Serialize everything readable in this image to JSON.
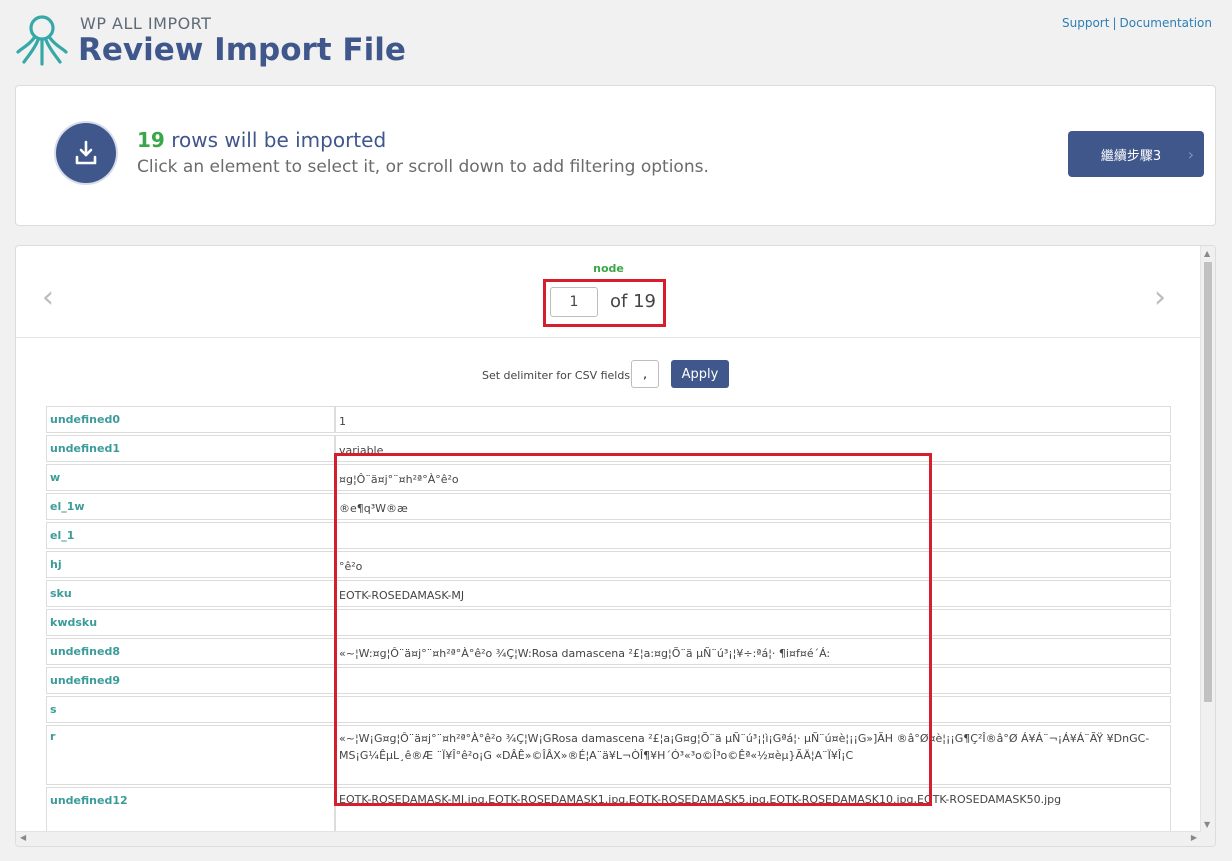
{
  "header": {
    "brand": "WP ALL IMPORT",
    "title": "Review Import File",
    "support_link": "Support",
    "separator": "|",
    "documentation_link": "Documentation"
  },
  "summary": {
    "rows_count": "19",
    "rows_text": "rows will be imported",
    "instruction": "Click an element to select it, or scroll down to add filtering options.",
    "continue_label": "繼續步驟3",
    "continue_chevron": "›"
  },
  "navigator": {
    "node_label": "node",
    "current_value": "1",
    "total_text": "of 19",
    "prev_glyph": "‹",
    "next_glyph": "›"
  },
  "delimiter": {
    "label": "Set delimiter for CSV fields:",
    "value": ",",
    "apply_label": "Apply"
  },
  "fields": [
    {
      "key": "undefined0",
      "value": "1"
    },
    {
      "key": "undefined1",
      "value": "variable"
    },
    {
      "key": "w",
      "value": "¤g¦Ô¨ä¤j°¨¤h²ª°À°ê²o"
    },
    {
      "key": "el_1w",
      "value": "®e¶q³W®æ"
    },
    {
      "key": "el_1",
      "value": ""
    },
    {
      "key": "hj",
      "value": "°ê²o"
    },
    {
      "key": "sku",
      "value": "EOTK-ROSEDAMASK-MJ"
    },
    {
      "key": "kwdsku",
      "value": ""
    },
    {
      "key": "undefined8",
      "value": "«~¦W:¤g¦Ô¨ä¤j°¨¤h²ª°À°ê²o ¾Ç¦W:Rosa damascena ²£¦a:¤g¦Õ¨ä µÑ¨ú³¡¦¥÷:ªá¦· ¶i¤f¤é´Á:"
    },
    {
      "key": "undefined9",
      "value": ""
    },
    {
      "key": "s",
      "value": ""
    },
    {
      "key": "r",
      "value": "«~¦W¡G¤g¦Ô¨ä¤j°¨¤h²ª°À°ê²o ¾Ç¦W¡GRosa damascena ²£¦a¡G¤g¦Õ¨ä µÑ¨ú³¡¦ì¡Gªá¦· µÑ¨ú¤è¦¡¡G»]ÃH ®â°Ø¤è¦¡¡G¶Ç²Î®â°Ø Á¥Á¨¬¡Á¥Á¨ÃŸ ¥DnGC-MS¡G¼ÊµL¸ê®Æ ¨Ï¥Î°ê²o¡G «DÂÊ»©ÎÂX»®É¦A¨ä¥L¬ÒÎ¶¥H´Ó³«³o©Î³o©Êª«½¤èµ}ÃÄ¦A¨Ï¥Î¡C"
    },
    {
      "key": "undefined12",
      "value": "EOTK-ROSEDAMASK-MJ.jpg,EOTK-ROSEDAMASK1.jpg,EOTK-ROSEDAMASK5.jpg,EOTK-ROSEDAMASK10.jpg,EOTK-ROSEDAMASK50.jpg"
    }
  ],
  "colors": {
    "accent": "#40578c",
    "count_green": "#3aa647",
    "field_key_teal": "#3b9c9a",
    "highlight_red": "#d61f2c"
  },
  "icons": {
    "logo": "octopus-logo-icon",
    "download": "download-icon"
  }
}
